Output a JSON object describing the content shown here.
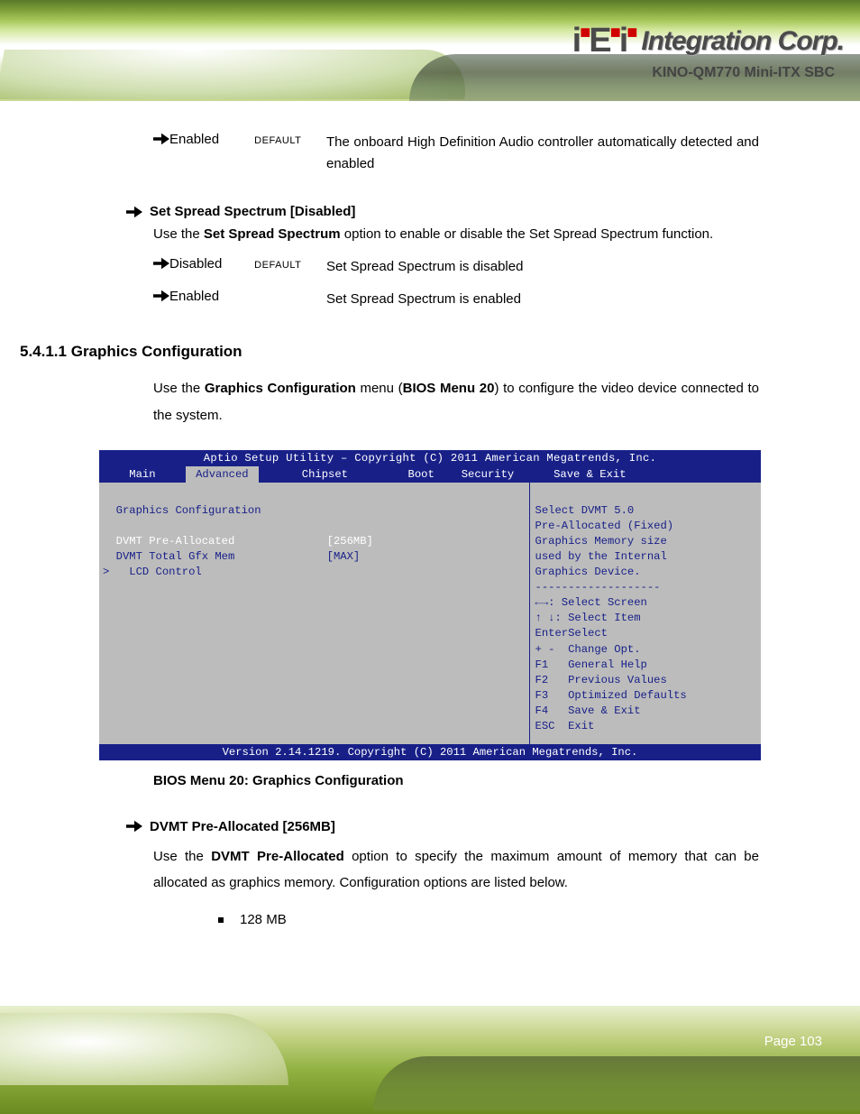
{
  "header": {
    "logo_text": "Integration Corp.",
    "product_line": "KINO-QM770 Mini-ITX SBC"
  },
  "opt_enabled": {
    "label": "Enabled",
    "default": "DEFAULT",
    "desc": "The onboard High Definition Audio controller automatically detected and enabled"
  },
  "spread": {
    "heading": "Set Spread Spectrum [Disabled]",
    "intro_pre": "Use the ",
    "intro_bold": "Set Spread Spectrum",
    "intro_post": " option to enable or disable the Set Spread Spectrum function.",
    "opt_disabled": {
      "label": "Disabled",
      "default": "DEFAULT",
      "desc": "Set Spread Spectrum is disabled"
    },
    "opt_enabled": {
      "label": "Enabled",
      "desc": "Set Spread Spectrum is enabled"
    }
  },
  "gfx_section": {
    "number": "5.4.1.1 ",
    "title": "Graphics Configuration",
    "intro_pre": "Use the ",
    "intro_bold": "Graphics Configuration",
    "intro_mid": " menu (",
    "intro_ref": "BIOS Menu 20",
    "intro_post": ") to configure the video device connected to the system."
  },
  "bios": {
    "title": "Aptio Setup Utility – Copyright (C) 2011 American Megatrends, Inc.",
    "tabs": [
      "    Main    ",
      " Advanced ",
      "      Chipset      ",
      "  Boot  ",
      " Security      Save & Exit "
    ],
    "left": [
      "  Graphics Configuration",
      "",
      "  DVMT Pre-Allocated              [256MB]",
      "  DVMT Total Gfx Mem              [MAX]",
      "  LCD Control"
    ],
    "right_top": [
      "Select DVMT 5.0",
      "Pre-Allocated (Fixed)",
      "Graphics Memory size",
      "used by the Internal",
      "Graphics Device.",
      "-------------------"
    ],
    "right_nav": [
      "←→: Select Screen",
      "↑ ↓: Select Item",
      "EnterSelect",
      "+ -  Change Opt.",
      "F1   General Help",
      "F2   Previous Values",
      "F3   Optimized Defaults",
      "F4   Save & Exit",
      "ESC  Exit"
    ],
    "footer": "Version 2.14.1219. Copyright (C) 2011 American Megatrends, Inc.",
    "caption": "BIOS Menu 20: Graphics Configuration"
  },
  "dvmt": {
    "heading": "DVMT Pre-Allocated [256MB]",
    "intro_pre": "Use the ",
    "intro_bold": "DVMT Pre-Allocated",
    "intro_post": " option to specify the maximum amount of memory that can be allocated as graphics memory. Configuration options are listed below.",
    "bullet1": "128 MB"
  },
  "footer": {
    "page_label_pre": "Page ",
    "page_num": "103"
  }
}
